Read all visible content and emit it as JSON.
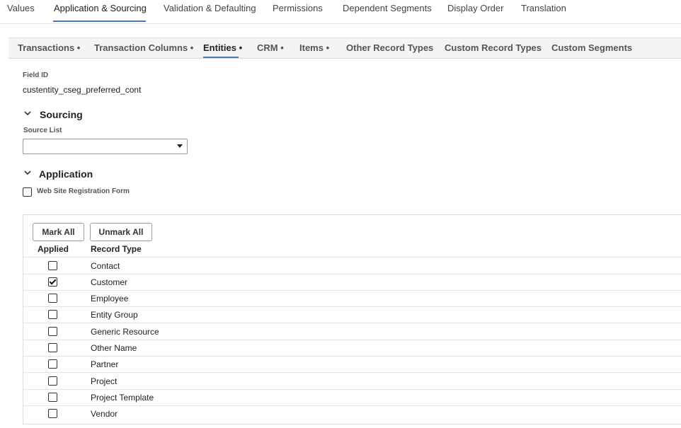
{
  "top_tabs": [
    {
      "label": "Values"
    },
    {
      "label": "Application & Sourcing"
    },
    {
      "label": "Validation & Defaulting"
    },
    {
      "label": "Permissions"
    },
    {
      "label": "Dependent Segments"
    },
    {
      "label": "Display Order"
    },
    {
      "label": "Translation"
    }
  ],
  "sub_tabs": [
    {
      "label": "Transactions •"
    },
    {
      "label": "Transaction Columns •"
    },
    {
      "label": "Entities •"
    },
    {
      "label": "CRM •"
    },
    {
      "label": "Items •"
    },
    {
      "label": "Other Record Types"
    },
    {
      "label": "Custom Record Types"
    },
    {
      "label": "Custom Segments"
    }
  ],
  "field": {
    "label": "Field ID",
    "value": "custentity_cseg_preferred_cont"
  },
  "sourcing": {
    "title": "Sourcing",
    "source_list_label": "Source List",
    "source_list_value": ""
  },
  "application": {
    "title": "Application",
    "web_reg_label": "Web Site Registration Form",
    "web_reg_checked": false
  },
  "buttons": {
    "mark_all": "Mark All",
    "unmark_all": "Unmark All"
  },
  "columns": {
    "applied": "Applied",
    "record_type": "Record Type"
  },
  "rows": [
    {
      "record_type": "Contact",
      "applied": false
    },
    {
      "record_type": "Customer",
      "applied": true
    },
    {
      "record_type": "Employee",
      "applied": false
    },
    {
      "record_type": "Entity Group",
      "applied": false
    },
    {
      "record_type": "Generic Resource",
      "applied": false
    },
    {
      "record_type": "Other Name",
      "applied": false
    },
    {
      "record_type": "Partner",
      "applied": false
    },
    {
      "record_type": "Project",
      "applied": false
    },
    {
      "record_type": "Project Template",
      "applied": false
    },
    {
      "record_type": "Vendor",
      "applied": false
    }
  ],
  "colors": {
    "accent": "#4d78ad"
  }
}
